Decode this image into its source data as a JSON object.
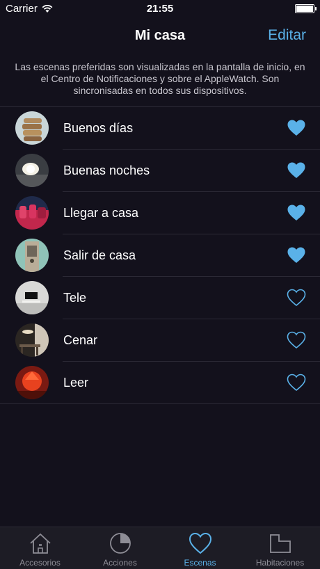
{
  "status_bar": {
    "carrier": "Carrier",
    "time": "21:55"
  },
  "nav": {
    "title": "Mi casa",
    "edit_label": "Editar"
  },
  "description": "Las escenas preferidas son visualizadas en la pantalla de inicio, en el Centro de Notificaciones y sobre el AppleWatch. Son sincronisadas en todos sus dispositivos.",
  "scenes": [
    {
      "label": "Buenos días",
      "favorite": true
    },
    {
      "label": "Buenas noches",
      "favorite": true
    },
    {
      "label": "Llegar a casa",
      "favorite": true
    },
    {
      "label": "Salir de casa",
      "favorite": true
    },
    {
      "label": "Tele",
      "favorite": false
    },
    {
      "label": "Cenar",
      "favorite": false
    },
    {
      "label": "Leer",
      "favorite": false
    }
  ],
  "tabs": [
    {
      "label": "Accesorios",
      "active": false
    },
    {
      "label": "Acciones",
      "active": false
    },
    {
      "label": "Escenas",
      "active": true
    },
    {
      "label": "Habitaciones",
      "active": false
    }
  ],
  "colors": {
    "accent": "#5ab1e8",
    "background": "#13111c",
    "tab_bar": "#1d1c25"
  }
}
